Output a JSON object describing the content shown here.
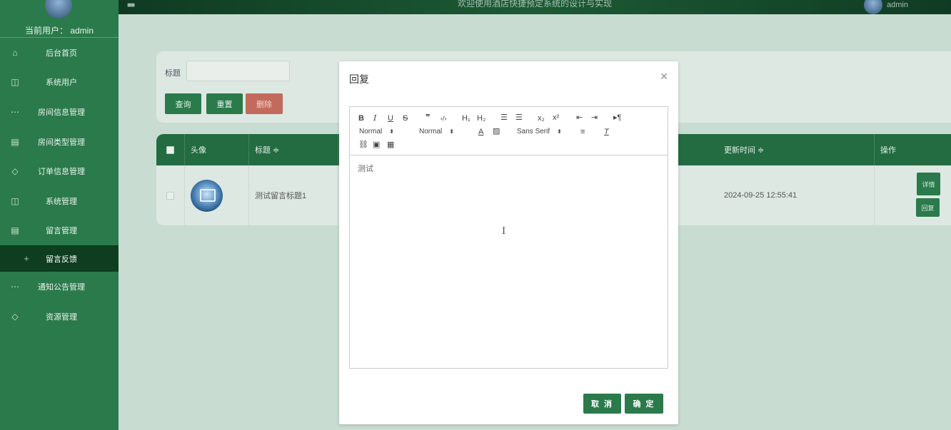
{
  "sidebar": {
    "current_user": "当前用户：  admin",
    "items": [
      {
        "label": "后台首页",
        "icon": "home-icon"
      },
      {
        "label": "系统用户",
        "icon": "columns-icon"
      },
      {
        "label": "房间信息管理",
        "icon": "chat-icon"
      },
      {
        "label": "房间类型管理",
        "icon": "document-icon"
      },
      {
        "label": "订单信息管理",
        "icon": "shield-icon"
      },
      {
        "label": "系统管理",
        "icon": "columns-icon"
      },
      {
        "label": "留言管理",
        "icon": "document-icon"
      },
      {
        "label": "留言反馈",
        "icon": "plus-icon"
      },
      {
        "label": "通知公告管理",
        "icon": "chat-icon"
      },
      {
        "label": "资源管理",
        "icon": "shield-icon"
      }
    ]
  },
  "topbar": {
    "title": "欢迎使用酒店快捷预定系统的设计与实现",
    "username": "admin"
  },
  "search": {
    "label": "标题",
    "query_label": "查询",
    "reset_label": "重置",
    "delete_label": "删除"
  },
  "table": {
    "headers": {
      "avatar": "头像",
      "title": "标题 ≑",
      "updated": "更新时间 ≑",
      "actions": "操作"
    },
    "rows": [
      {
        "title": "测试留言标题1",
        "updated": "2024-09-25 12:55:41",
        "detail_label": "详情",
        "reply_label": "回复"
      }
    ]
  },
  "modal": {
    "title": "回复",
    "editor": {
      "content": "测试",
      "header_select": "Normal",
      "size_select": "Normal",
      "font_select": "Sans Serif"
    },
    "cancel_label": "取 消",
    "ok_label": "确 定"
  }
}
